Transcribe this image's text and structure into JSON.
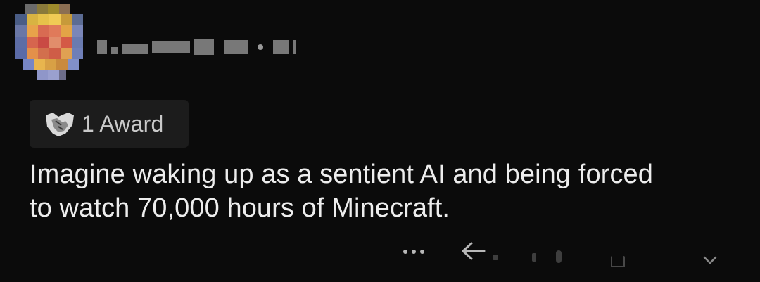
{
  "comment": {
    "award_label": "1 Award",
    "body_line1": "Imagine waking up as a sentient AI and being forced",
    "body_line2": "to watch 70,000 hours of Minecraft."
  },
  "icons": {
    "award": "handshake-award-icon",
    "avatar": "pixelated-avatar",
    "more": "more-options-icon",
    "reply": "reply-arrow-icon",
    "upvote": "upvote-icon",
    "downvote": "downvote-icon",
    "share": "share-icon"
  },
  "colors": {
    "background": "#0b0b0b",
    "text": "#ededed",
    "chip_background": "#1c1c1c",
    "muted_text": "#c9c9c9"
  }
}
